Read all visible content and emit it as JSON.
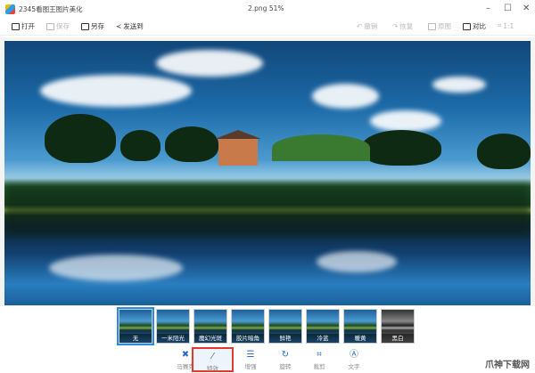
{
  "app_title": "2345看图王图片美化",
  "file_title": "2.png  51%",
  "window_controls": {
    "minimize": "–",
    "maximize": "☐",
    "close": "✕"
  },
  "toolbar": {
    "open": "打开",
    "save": "保存",
    "save_as": "另存",
    "send_to": "发送到",
    "undo": "撤销",
    "redo": "恢复",
    "original": "原图",
    "compare": "对比",
    "one_to_one": "1:1"
  },
  "effects": [
    {
      "label": "无",
      "selected": true
    },
    {
      "label": "一米阳光"
    },
    {
      "label": "魔幻光斑"
    },
    {
      "label": "胶片暗角"
    },
    {
      "label": "鲜艳"
    },
    {
      "label": "冷蓝"
    },
    {
      "label": "暖黄"
    },
    {
      "label": "黑白"
    }
  ],
  "tools": {
    "mosaic": "马赛克",
    "effects": "特效",
    "enhance": "增强",
    "rotate": "旋转",
    "crop": "裁剪",
    "text": "文字"
  },
  "tool_icons": {
    "mosaic": "✖",
    "effects": "⁄",
    "enhance": "☰",
    "rotate": "↻",
    "crop": "⌗",
    "text": "Ⓐ"
  },
  "watermark": "爪神下载网"
}
